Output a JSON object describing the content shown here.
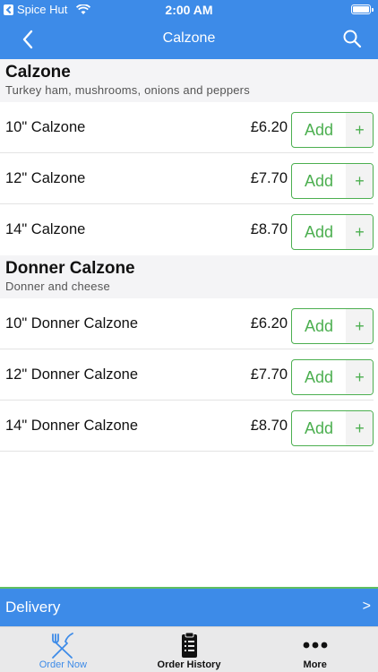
{
  "status_bar": {
    "carrier": "Spice Hut",
    "time": "2:00 AM"
  },
  "nav": {
    "title": "Calzone"
  },
  "sections": [
    {
      "title": "Calzone",
      "subtitle": "Turkey ham, mushrooms, onions and peppers",
      "items": [
        {
          "name": "10\" Calzone",
          "price": "£6.20"
        },
        {
          "name": "12\" Calzone",
          "price": "£7.70"
        },
        {
          "name": "14\" Calzone",
          "price": "£8.70"
        }
      ]
    },
    {
      "title": "Donner Calzone",
      "subtitle": "Donner and cheese",
      "items": [
        {
          "name": "10\" Donner Calzone",
          "price": "£6.20"
        },
        {
          "name": "12\" Donner Calzone",
          "price": "£7.70"
        },
        {
          "name": "14\" Donner Calzone",
          "price": "£8.70"
        }
      ]
    }
  ],
  "add_button": {
    "label": "Add",
    "plus": "+"
  },
  "delivery": {
    "label": "Delivery",
    "arrow": ">"
  },
  "tabs": [
    {
      "label": "Order Now",
      "icon": "fork-knife-icon",
      "active": true
    },
    {
      "label": "Order History",
      "icon": "clipboard-icon",
      "active": false
    },
    {
      "label": "More",
      "icon": "more-dots-icon",
      "active": false
    }
  ],
  "colors": {
    "primary": "#3d8be8",
    "accent_green": "#4caf50",
    "section_bg": "#f4f4f6"
  }
}
